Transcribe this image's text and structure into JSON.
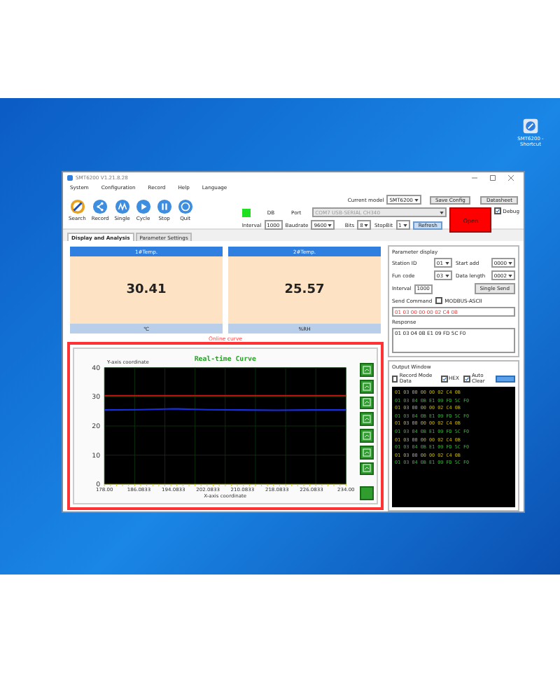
{
  "desktop": {
    "shortcut": {
      "label": "SMT6200 - Shortcut"
    }
  },
  "window": {
    "title": "SMT6200  V1.21.8.28"
  },
  "menu": [
    "System",
    "Configuration",
    "Record",
    "Help",
    "Language"
  ],
  "toolbar": [
    {
      "label": "Search",
      "kind": "search"
    },
    {
      "label": "Record",
      "kind": "share"
    },
    {
      "label": "Single",
      "kind": "wave"
    },
    {
      "label": "Cycle",
      "kind": "play"
    },
    {
      "label": "Stop",
      "kind": "pause"
    },
    {
      "label": "Quit",
      "kind": "ring"
    }
  ],
  "connection": {
    "model": {
      "label": "Current model",
      "value": "SMT6200"
    },
    "save_config": "Save Config",
    "datasheet": "Datasheet",
    "status": {
      "label": "DB",
      "on": true
    },
    "port": {
      "label": "Port",
      "value": "COM7 USB-SERIAL CH340",
      "disabled": true
    },
    "interval": {
      "label": "Interval",
      "value": "1000"
    },
    "baudrate": {
      "label": "Baudrate",
      "value": "9600"
    },
    "bits": {
      "label": "Bits",
      "value": "8"
    },
    "stopbit": {
      "label": "StopBit",
      "value": "1"
    },
    "refresh": "Refresh",
    "open": "Open",
    "debug": {
      "label": "Debug",
      "checked": true
    }
  },
  "tabs": [
    {
      "label": "Display and Analysis",
      "selected": true
    },
    {
      "label": "Parameter Settings",
      "selected": false
    }
  ],
  "cards": [
    {
      "title": "1#Temp.",
      "value": "30.41",
      "unit": "℃"
    },
    {
      "title": "2#Temp.",
      "value": "25.57",
      "unit": "%RH"
    }
  ],
  "curve": {
    "label": "Online curve",
    "chart_data": {
      "type": "line",
      "title": "Real-time Curve",
      "xlabel": "X-axis coordinate",
      "ylabel": "Y-axis coordinate",
      "grid": true,
      "categories": [
        "178.00",
        "186.0833",
        "194.0833",
        "202.0833",
        "210.0833",
        "218.0833",
        "226.0833",
        "234.00"
      ],
      "ylim": [
        0,
        40
      ],
      "yticks": [
        0,
        10,
        20,
        30,
        40
      ],
      "series": [
        {
          "color": "#c01818",
          "values": [
            30.4,
            30.4,
            30.4,
            30.4,
            30.4,
            30.4,
            30.4,
            30.4
          ]
        },
        {
          "color": "#1830e0",
          "values": [
            25.5,
            25.6,
            25.9,
            25.6,
            25.5,
            25.4,
            25.5,
            25.5
          ]
        }
      ]
    }
  },
  "parameters": {
    "title": "Parameter display",
    "fields": [
      {
        "label": "Station ID",
        "value": "01"
      },
      {
        "label": "Start add",
        "value": "0000"
      },
      {
        "label": "Fun code",
        "value": "03"
      },
      {
        "label": "Data length",
        "value": "0002"
      }
    ],
    "interval": {
      "label": "Interval",
      "value": "1000"
    },
    "single_send": "Single Send",
    "send_command": {
      "label": "Send Command",
      "option": {
        "label": "MODBUS-ASCII",
        "checked": false
      },
      "value": "01 03 00 00 00 02 C4 0B"
    },
    "response": {
      "label": "Response",
      "value": "01 03 04 0B E1 09 FD 5C F0"
    }
  },
  "output": {
    "title": "Output Window",
    "options": [
      {
        "label": "Record Mode Data",
        "checked": false
      },
      {
        "label": "HEX",
        "checked": true
      },
      {
        "label": "Auto Clear",
        "checked": true
      }
    ],
    "lines": [
      {
        "kind": "sent",
        "text": "01 03 00 00 00 02 C4 0B"
      },
      {
        "kind": "received",
        "text": "01 03 04 0B E1 09 FD 5C F0"
      },
      {
        "kind": "sent",
        "text": "01 03 00 00 00 02 C4 0B"
      },
      {
        "kind": "received",
        "text": "01 03 04 0B E1 09 FD 5C F0"
      },
      {
        "kind": "sent",
        "text": "01 03 00 00 00 02 C4 0B"
      },
      {
        "kind": "received",
        "text": "01 03 04 0B E1 09 FD 5C F0"
      },
      {
        "kind": "sent",
        "text": "01 03 00 00 00 02 C4 0B"
      },
      {
        "kind": "received",
        "text": "01 03 04 0B E1 09 FD 5C F0"
      },
      {
        "kind": "sent",
        "text": "01 03 00 00 00 02 C4 0B"
      },
      {
        "kind": "received",
        "text": "01 03 04 0B E1 09 FD 5C F0"
      }
    ]
  }
}
